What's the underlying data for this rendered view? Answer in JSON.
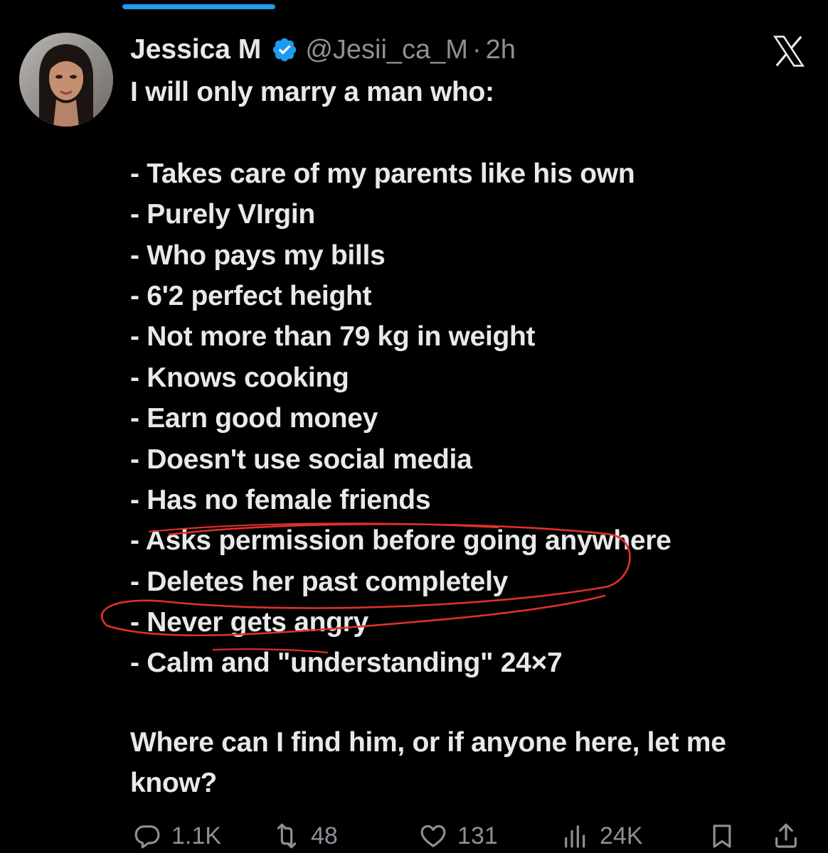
{
  "tweet": {
    "display_name": "Jessica M",
    "handle": "@Jesii_ca_M",
    "separator": "·",
    "time": "2h",
    "intro": "I will only marry a man who:",
    "list_items": [
      "- Takes care of my parents like his own",
      "- Purely VIrgin",
      "- Who pays my bills",
      "- 6'2 perfect height",
      "- Not more than 79 kg in weight",
      "- Knows cooking",
      "- Earn good money",
      "- Doesn't use social media",
      "- Has no female friends",
      "- Asks permission before going anywhere",
      "- Deletes her past completely",
      "- Never gets angry",
      "- Calm and \"understanding\" 24×7"
    ],
    "closing": "Where can I find him, or if anyone here, let me know?"
  },
  "actions": {
    "replies": "1.1K",
    "reposts": "48",
    "likes": "131",
    "views": "24K"
  },
  "icons": {
    "verified": "verified-badge-icon",
    "platform": "x-logo-icon",
    "reply": "reply-icon",
    "repost": "repost-icon",
    "like": "heart-icon",
    "views": "views-icon",
    "bookmark": "bookmark-icon",
    "share": "share-icon"
  },
  "colors": {
    "background": "#000000",
    "text": "#e7e9ea",
    "secondary": "#8b9197",
    "verified": "#1d9bf0",
    "annotation": "#e0302a"
  }
}
